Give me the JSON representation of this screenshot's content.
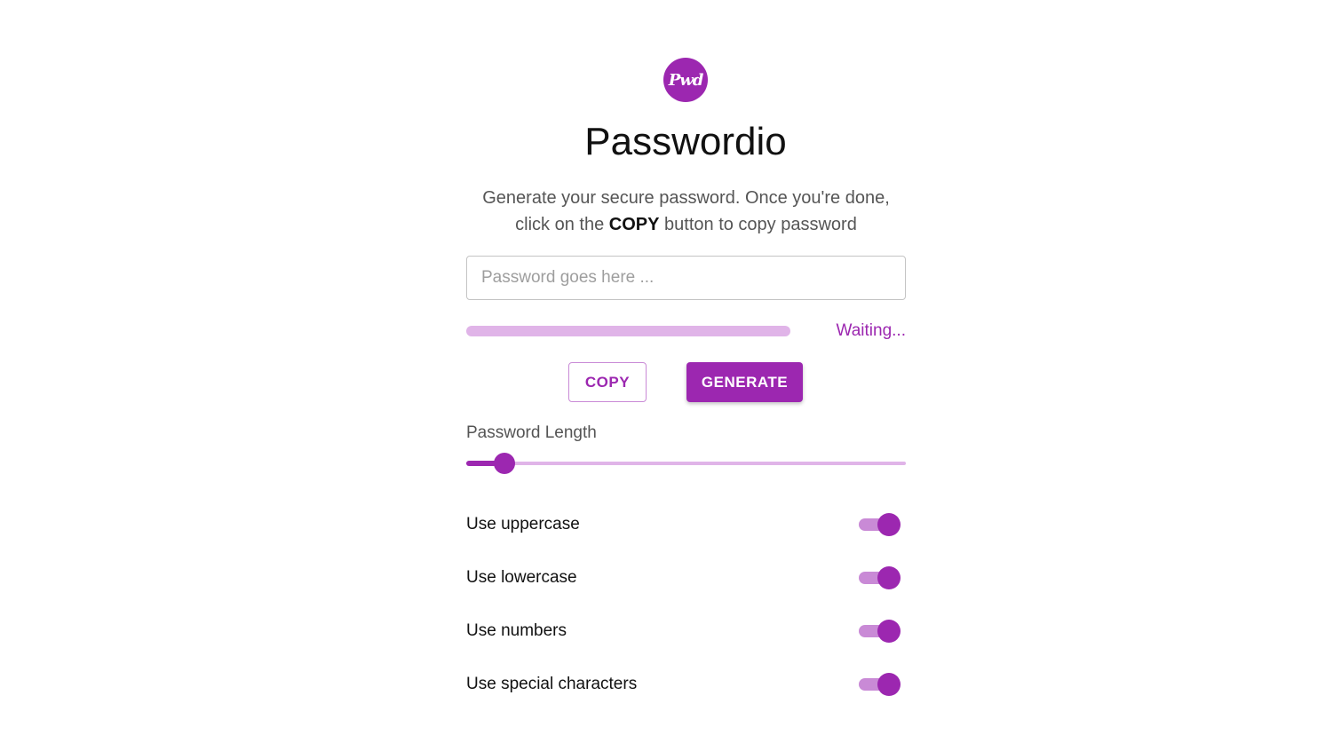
{
  "app": {
    "logo_text": "Pwd",
    "title": "Passwordio",
    "description_part1": "Generate your secure password. Once you're done,",
    "description_part2": "click on the ",
    "description_emphasis": "COPY",
    "description_part3": " button to copy password"
  },
  "password_field": {
    "placeholder": "Password goes here ...",
    "value": ""
  },
  "strength": {
    "status_text": "Waiting...",
    "level": 0
  },
  "buttons": {
    "copy_label": "COPY",
    "generate_label": "GENERATE"
  },
  "length": {
    "label": "Password Length",
    "fraction": 0.087
  },
  "options": [
    {
      "label": "Use uppercase",
      "checked": true
    },
    {
      "label": "Use lowercase",
      "checked": true
    },
    {
      "label": "Use numbers",
      "checked": true
    },
    {
      "label": "Use special characters",
      "checked": true
    }
  ],
  "colors": {
    "accent": "#9c27b0",
    "accent_light": "#e0b4e8",
    "switch_track": "#c98ad6"
  }
}
